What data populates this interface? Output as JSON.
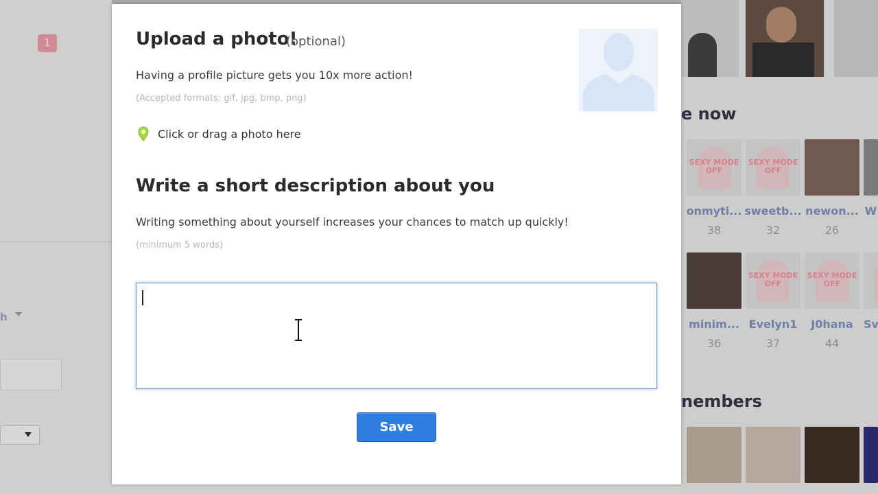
{
  "background": {
    "badge_count": "1",
    "partial_label": "h",
    "section_titles": {
      "online_now": "e now",
      "members": "nembers"
    },
    "off_text": "SEXY MODE OFF",
    "online_members": [
      {
        "name": "onmyti...",
        "age": "38",
        "photo": "off"
      },
      {
        "name": "sweetb...",
        "age": "32",
        "photo": "off"
      },
      {
        "name": "newon...",
        "age": "26",
        "photo": "photo"
      },
      {
        "name": "W",
        "age": "",
        "photo": "photo"
      },
      {
        "name": "minim...",
        "age": "36",
        "photo": "photo"
      },
      {
        "name": "Evelyn1",
        "age": "37",
        "photo": "off"
      },
      {
        "name": "J0hana",
        "age": "44",
        "photo": "off"
      },
      {
        "name": "Sv",
        "age": "",
        "photo": "off"
      }
    ]
  },
  "modal": {
    "upload": {
      "title": "Upload a photo!",
      "optional": "(optional)",
      "description": "Having a profile picture gets you 10x more action!",
      "formats": "(Accepted formats: gif, jpg, bmp, png)",
      "drop_label": "Click or drag a photo here",
      "pin_color": "#9acd32"
    },
    "description": {
      "title": "Write a short description about you",
      "subtitle": "Writing something about yourself increases your chances to match up quickly!",
      "minimum": "(minimum 5 words)",
      "value": ""
    },
    "save_label": "Save",
    "accent_color": "#2f7fe0"
  }
}
